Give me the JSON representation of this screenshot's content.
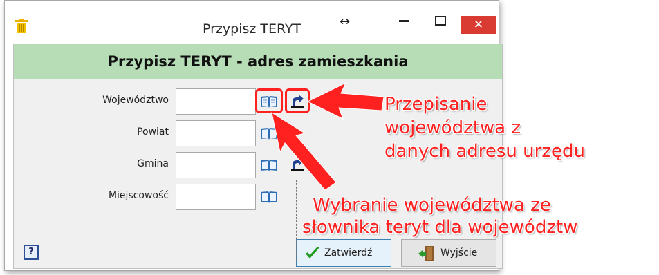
{
  "window": {
    "title": "Przypisz TERYT",
    "close_glyph": "✕",
    "resize_glyph": "↔"
  },
  "header": {
    "title": "Przypisz TERYT - adres zamieszkania"
  },
  "form": {
    "fields": [
      {
        "label": "Województwo",
        "value": ""
      },
      {
        "label": "Powiat",
        "value": ""
      },
      {
        "label": "Gmina",
        "value": ""
      },
      {
        "label": "Miejscowość",
        "value": ""
      }
    ]
  },
  "buttons": {
    "help": "?",
    "ok": "Zatwierdź",
    "exit": "Wyjście"
  },
  "annotations": {
    "top": [
      "Przepisanie",
      "województwa z",
      "danych adresu urzędu"
    ],
    "bottom": [
      "Wybranie województwa ze",
      "słownika teryt dla województw"
    ]
  },
  "colors": {
    "header_bg": "#b7ddb7",
    "close_bg": "#d93a32",
    "annotation": "#ff2020"
  },
  "icons": [
    "trash-icon",
    "book-icon",
    "copy-arrow-icon",
    "checkmark-icon",
    "exit-door-icon"
  ]
}
